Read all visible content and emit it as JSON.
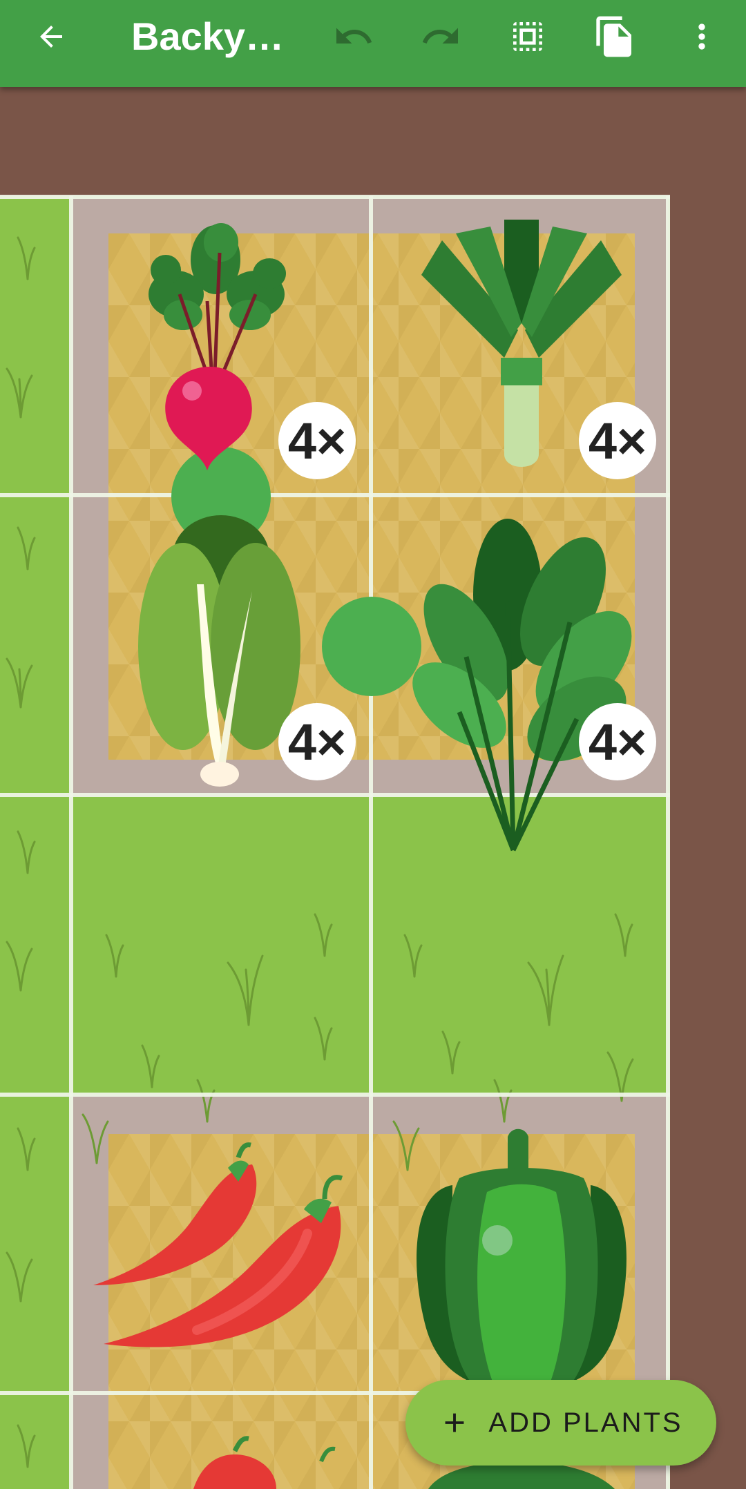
{
  "app_bar": {
    "title": "Backy…",
    "back_icon": "arrow-back-icon",
    "undo_icon": "undo-icon",
    "redo_icon": "redo-icon",
    "grid_icon": "grid-select-icon",
    "copy_icon": "copy-icon",
    "more_icon": "more-vertical-icon",
    "color": "#43a047"
  },
  "garden": {
    "background_color": "#7a5548",
    "grass_color": "#8bc34a",
    "bed_color": "#bcaaa4",
    "plants": [
      {
        "name": "Radish",
        "count_label": "4×"
      },
      {
        "name": "Leek",
        "count_label": "4×"
      },
      {
        "name": "Lettuce",
        "count_label": "4×"
      },
      {
        "name": "Spinach",
        "count_label": "4×"
      },
      {
        "name": "Chili pepper",
        "count_label": ""
      },
      {
        "name": "Bell pepper",
        "count_label": ""
      }
    ]
  },
  "fab": {
    "icon": "plus-icon",
    "label": "ADD PLANTS",
    "color": "#8bc34a"
  }
}
